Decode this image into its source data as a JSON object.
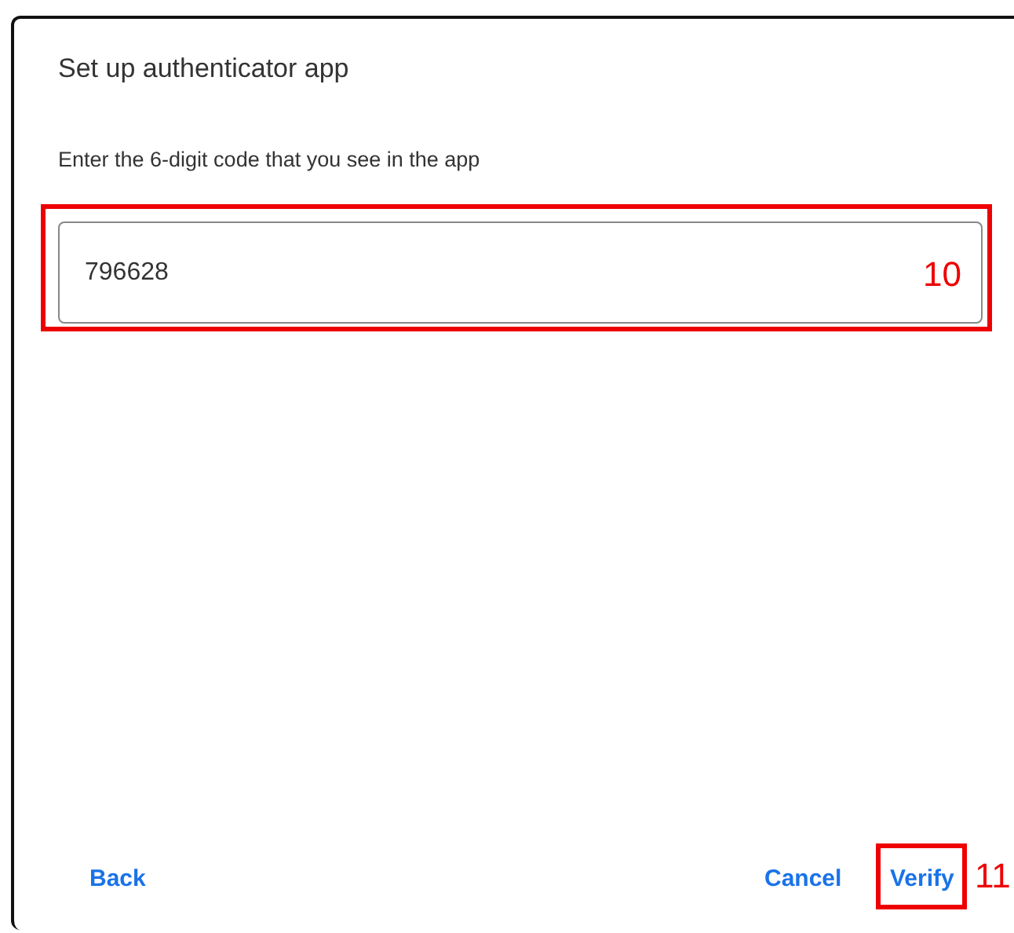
{
  "dialog": {
    "title": "Set up authenticator app",
    "instruction": "Enter the 6-digit code that you see in the app",
    "code_field": {
      "value": "796628",
      "callout": "10"
    },
    "buttons": [
      {
        "label": "Back"
      },
      {
        "label": "Cancel"
      },
      {
        "label": "Verify",
        "callout": "11"
      }
    ]
  }
}
